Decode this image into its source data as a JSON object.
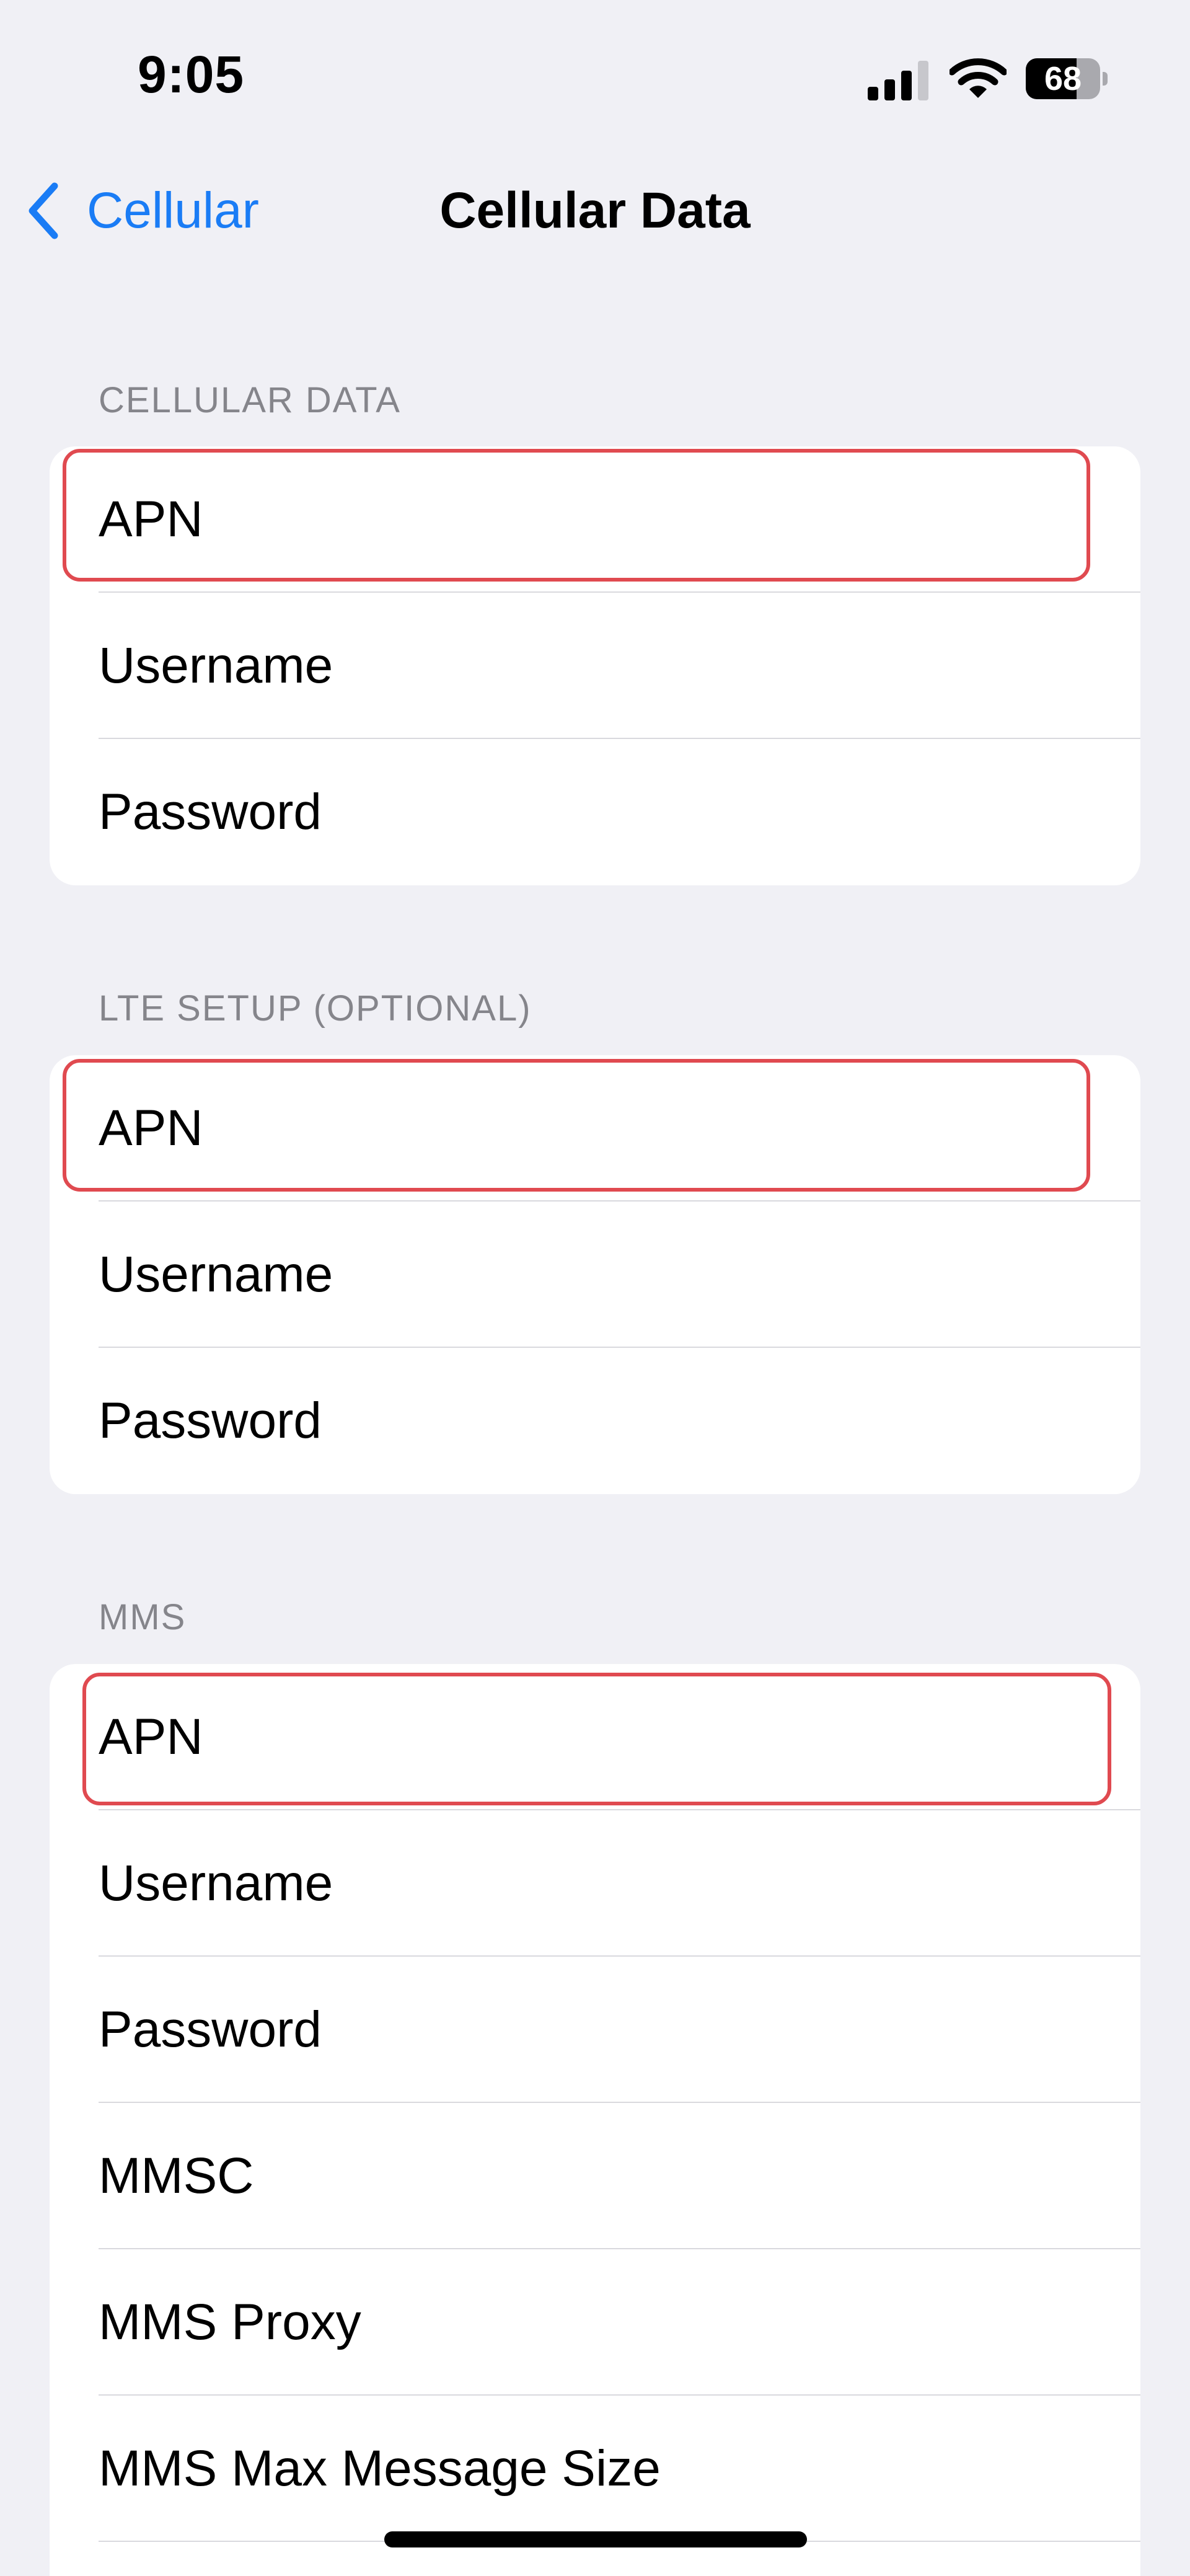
{
  "status_bar": {
    "time": "9:05",
    "battery_level": "68",
    "battery_fraction": 0.68
  },
  "nav": {
    "back_label": "Cellular",
    "title": "Cellular Data"
  },
  "sections": [
    {
      "header": "CELLULAR DATA",
      "rows": [
        "APN",
        "Username",
        "Password"
      ]
    },
    {
      "header": "LTE SETUP (OPTIONAL)",
      "rows": [
        "APN",
        "Username",
        "Password"
      ]
    },
    {
      "header": "MMS",
      "rows": [
        "APN",
        "Username",
        "Password",
        "MMSC",
        "MMS Proxy",
        "MMS Max Message Size"
      ]
    }
  ],
  "colors": {
    "accent": "#1A7CF5",
    "highlight": "#E04A50",
    "background": "#F0F0F5"
  },
  "icons": [
    "signal-icon",
    "wifi-icon",
    "battery-icon",
    "chevron-left-icon"
  ]
}
